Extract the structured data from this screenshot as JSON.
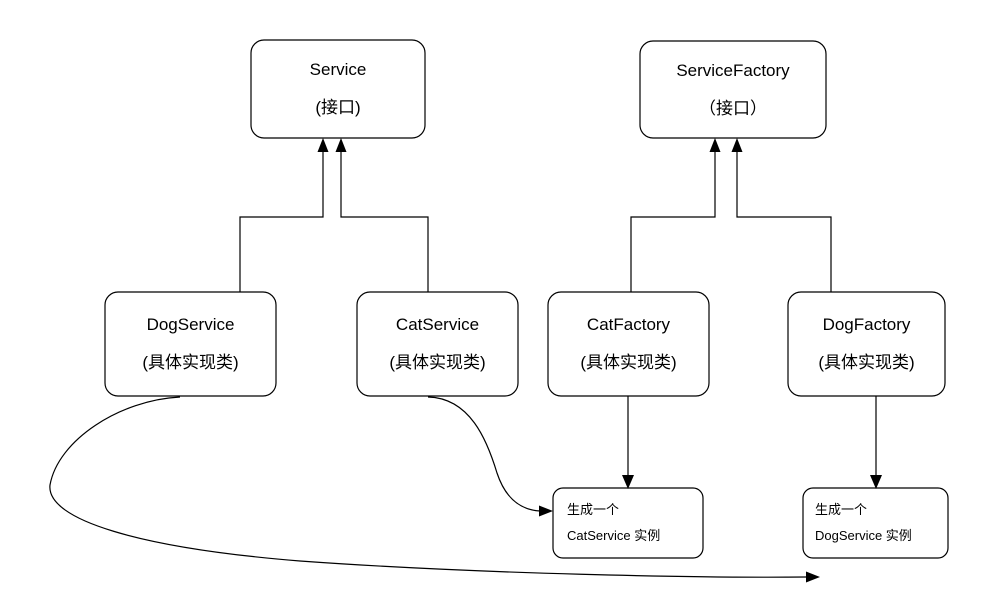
{
  "diagram": {
    "type": "uml-class-diagram",
    "background_color": "#ffffff",
    "line_color": "#000000",
    "text_color": "#000000",
    "nodes": [
      {
        "id": "service",
        "title": "Service",
        "subtitle": "(接口)",
        "role": "interface"
      },
      {
        "id": "service_factory",
        "title": "ServiceFactory",
        "subtitle": "（接口）",
        "role": "interface"
      },
      {
        "id": "dog_service",
        "title": "DogService",
        "subtitle": "(具体实现类)",
        "role": "concrete-class"
      },
      {
        "id": "cat_service",
        "title": "CatService",
        "subtitle": "(具体实现类)",
        "role": "concrete-class"
      },
      {
        "id": "cat_factory",
        "title": "CatFactory",
        "subtitle": "(具体实现类)",
        "role": "concrete-class"
      },
      {
        "id": "dog_factory",
        "title": "DogFactory",
        "subtitle": "(具体实现类)",
        "role": "concrete-class"
      }
    ],
    "notes": [
      {
        "id": "note_cat_instance",
        "line1": "生成一个",
        "line2": "CatService 实例"
      },
      {
        "id": "note_dog_instance",
        "line1": "生成一个",
        "line2": "DogService 实例"
      }
    ],
    "edges": [
      {
        "from": "dog_service",
        "to": "service",
        "style": "orthogonal-arrow"
      },
      {
        "from": "cat_service",
        "to": "service",
        "style": "orthogonal-arrow"
      },
      {
        "from": "cat_factory",
        "to": "service_factory",
        "style": "orthogonal-arrow"
      },
      {
        "from": "dog_factory",
        "to": "service_factory",
        "style": "orthogonal-arrow"
      },
      {
        "from": "cat_factory",
        "to": "note_cat_instance",
        "style": "straight-arrow"
      },
      {
        "from": "dog_factory",
        "to": "note_dog_instance",
        "style": "straight-arrow"
      },
      {
        "from": "cat_service",
        "to": "note_cat_instance",
        "style": "curved-arrow"
      },
      {
        "from": "dog_service",
        "to": "note_dog_instance",
        "style": "curved-arrow"
      }
    ]
  }
}
